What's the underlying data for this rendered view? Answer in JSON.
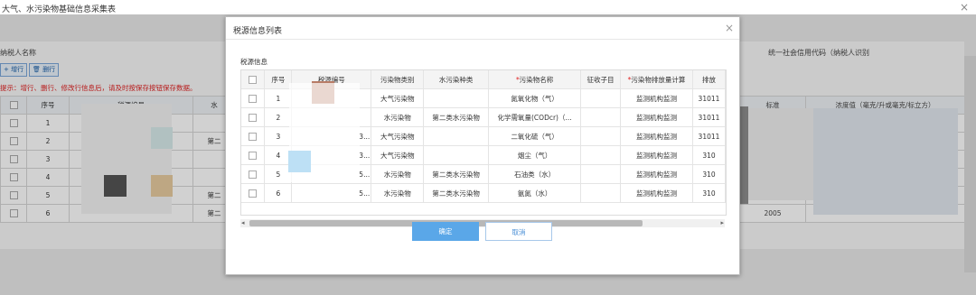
{
  "window": {
    "title": "大气、水污染物基础信息采集表",
    "close_glyph": "×"
  },
  "background": {
    "taxpayer_name_label": "纳税人名称",
    "credit_code_label": "统一社会信用代码（纳税人识别",
    "add_row": "+ 增行",
    "delete_row": "删行",
    "tip": "提示：增行、删行、修改行信息后，请及时按保存按钮保存数据。",
    "columns": [
      "序号",
      "税源编号",
      "水"
    ],
    "rows": [
      "1",
      "2",
      "3",
      "4",
      "5",
      "6"
    ],
    "row_extra": [
      "",
      "第二",
      "",
      "",
      "第二",
      "第二"
    ],
    "right_columns": [
      "标准",
      "浓度值（毫克/升或毫克/标立方）"
    ],
    "right_partial": [
      "",
      "",
      ")",
      "",
      "",
      "2005"
    ]
  },
  "modal": {
    "title": "税源信息列表",
    "close_glyph": "×",
    "section_label": "税源信息",
    "columns": [
      "",
      "序号",
      "税源编号",
      "污染物类别",
      "水污染种类",
      "*污染物名称",
      "征收子目",
      "*污染物排放量计算",
      "排放"
    ],
    "rows": [
      {
        "seq": "1",
        "code": "",
        "category": "大气污染物",
        "water_type": "",
        "pollutant": "氮氧化物（气）",
        "sub_item": "",
        "calc": "监测机构监测",
        "out": "31011"
      },
      {
        "seq": "2",
        "code": "",
        "category": "水污染物",
        "water_type": "第二类水污染物",
        "pollutant": "化学需氧量(CODcr)（...",
        "sub_item": "",
        "calc": "监测机构监测",
        "out": "31011"
      },
      {
        "seq": "3",
        "code": "3...",
        "category": "大气污染物",
        "water_type": "",
        "pollutant": "二氧化硫（气）",
        "sub_item": "",
        "calc": "监测机构监测",
        "out": "31011"
      },
      {
        "seq": "4",
        "code": "3...",
        "category": "大气污染物",
        "water_type": "",
        "pollutant": "烟尘（气）",
        "sub_item": "",
        "calc": "监测机构监测",
        "out": "310"
      },
      {
        "seq": "5",
        "code": "5...",
        "category": "水污染物",
        "water_type": "第二类水污染物",
        "pollutant": "石油类（水）",
        "sub_item": "",
        "calc": "监测机构监测",
        "out": "310"
      },
      {
        "seq": "6",
        "code": "5...",
        "category": "水污染物",
        "water_type": "第二类水污染物",
        "pollutant": "氨氮（水）",
        "sub_item": "",
        "calc": "监测机构监测",
        "out": "310"
      }
    ],
    "ok_label": "确定",
    "cancel_label": "取消"
  }
}
